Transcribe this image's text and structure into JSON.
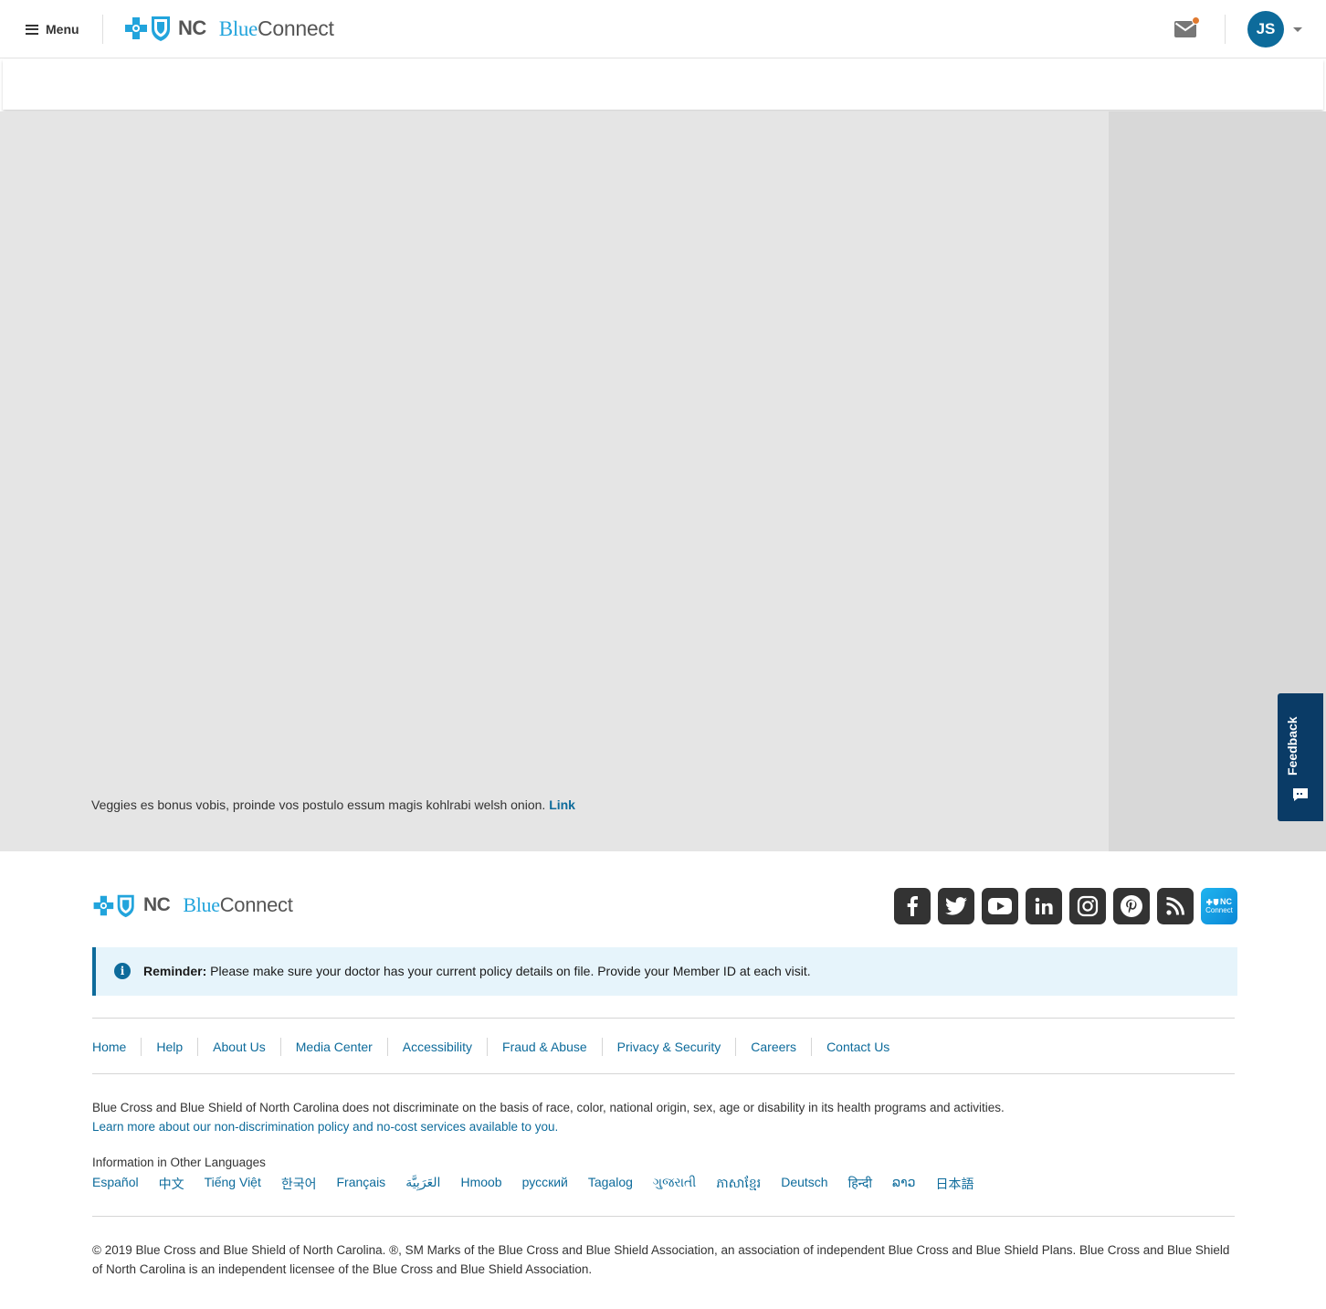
{
  "header": {
    "menu_label": "Menu",
    "logo_nc": "NC",
    "logo_blue": "Blue",
    "logo_connect": "Connect",
    "avatar_initials": "JS",
    "notification_color": "#e07a30",
    "accent_color": "#0d6b9b"
  },
  "main": {
    "body_text": "Veggies es bonus vobis, proinde vos postulo essum magis kohlrabi welsh onion.",
    "link_text": "Link"
  },
  "feedback": {
    "label": "Feedback"
  },
  "footer": {
    "logo_nc": "NC",
    "logo_blue": "Blue",
    "logo_connect": "Connect",
    "social_icons": [
      "facebook-icon",
      "twitter-icon",
      "youtube-icon",
      "linkedin-icon",
      "instagram-icon",
      "pinterest-icon",
      "rss-icon",
      "blue-connect-app-icon"
    ],
    "app_icon_text": "NC",
    "app_icon_sub": "Connect",
    "reminder_label": "Reminder:",
    "reminder_text": "Please make sure your doctor has your current policy details on file. Provide your Member ID at each visit.",
    "links": [
      "Home",
      "Help",
      "About Us",
      "Media Center",
      "Accessibility",
      "Fraud & Abuse",
      "Privacy & Security",
      "Careers",
      "Contact Us"
    ],
    "disclaimer": "Blue Cross and Blue Shield of North Carolina does not discriminate on the basis of race, color, national origin, sex, age or disability in its health programs and activities.",
    "disclaimer_link": "Learn more about our non-discrimination policy and no-cost services available to you.",
    "languages_title": "Information in Other Languages",
    "languages": [
      "Español",
      "中文",
      "Tiếng Việt",
      "한국어",
      "Français",
      "العَرَبِيَّة",
      "Hmoob",
      "русский",
      "Tagalog",
      "ગુજરાતી",
      "ភាសាខ្មែរ",
      "Deutsch",
      "हिन्दी",
      "ລາວ",
      "日本語"
    ],
    "copyright": "© 2019 Blue Cross and Blue Shield of North Carolina. ®, SM Marks of the Blue Cross and Blue Shield Association, an association of independent Blue Cross and Blue Shield Plans. Blue Cross and Blue Shield of North Carolina is an independent licensee of the Blue Cross and Blue Shield Association."
  }
}
